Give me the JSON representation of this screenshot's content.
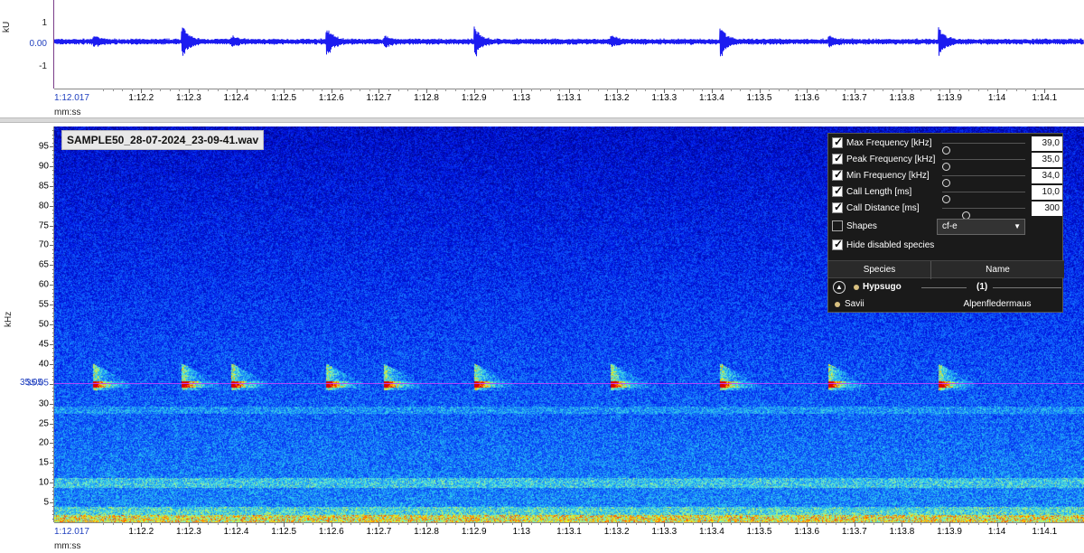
{
  "waveform": {
    "unit": "kU",
    "y_ticks": [
      {
        "label": "1",
        "value": 1
      },
      {
        "label": "0.00",
        "value": 0,
        "highlight": true
      },
      {
        "label": "-1",
        "value": -1
      }
    ],
    "time_axis_unit": "mm:ss",
    "color": "#1c1cf0",
    "pulse_times": [
      1.12024,
      1.12058,
      1.12088,
      1.12108,
      1.12188,
      1.12257,
      1.12324,
      1.12344,
      1.12387,
      1.12412,
      1.12443,
      1.12474,
      1.12555,
      1.12609,
      1.12643,
      1.12656,
      1.12727,
      1.12774,
      1.12826,
      1.12862
    ]
  },
  "time_axis": {
    "start_label": "1:12.017",
    "labels": [
      "1:12.2",
      "1:12.3",
      "1:12.4",
      "1:12.5",
      "1:12.6",
      "1:12.7",
      "1:12.8",
      "1:12.9",
      "1:13",
      "1:13.1",
      "1:13.2",
      "1:13.3",
      "1:13.4",
      "1:13.5",
      "1:13.6",
      "1:13.7",
      "1:13.8",
      "1:13.9",
      "1:14",
      "1:14.1"
    ]
  },
  "spectrogram": {
    "file_name": "SAMPLE50_28-07-2024_23-09-41.wav",
    "unit": "kHz",
    "y_ticks": [
      "95",
      "90",
      "85",
      "80",
      "75",
      "70",
      "65",
      "60",
      "55",
      "50",
      "45",
      "40",
      "35.05",
      "30",
      "25",
      "20",
      "15",
      "10",
      "5"
    ],
    "y_range_khz": [
      0,
      100
    ],
    "peak_marker_khz": 35.05,
    "peak_marker_label": "35.05",
    "calls_seconds": [
      72.1015,
      72.2885,
      72.393,
      72.592,
      72.7135,
      72.9035,
      73.191,
      73.4205,
      73.6475,
      73.8795
    ]
  },
  "params_panel": {
    "rows": [
      {
        "label": "Max Frequency [kHz]",
        "checked": true,
        "value": "39,0",
        "slider_frac": 0.0
      },
      {
        "label": "Peak Frequency [kHz]",
        "checked": true,
        "value": "35,0",
        "slider_frac": 0.0
      },
      {
        "label": "Min Frequency [kHz]",
        "checked": true,
        "value": "34,0",
        "slider_frac": 0.0
      },
      {
        "label": "Call Length [ms]",
        "checked": true,
        "value": "10,0",
        "slider_frac": 0.0
      },
      {
        "label": "Call Distance [ms]",
        "checked": true,
        "value": "300",
        "slider_frac": 0.25
      }
    ],
    "shapes": {
      "label": "Shapes",
      "checked": false,
      "selected": "cf-e"
    },
    "hide_disabled": {
      "label": "Hide disabled species",
      "checked": true
    },
    "species_table": {
      "headers": [
        "Species",
        "Name"
      ],
      "group": {
        "name": "Hypsugo",
        "count": "(1)"
      },
      "rows": [
        {
          "species": "Savii",
          "name": "Alpenfledermaus"
        }
      ]
    }
  }
}
